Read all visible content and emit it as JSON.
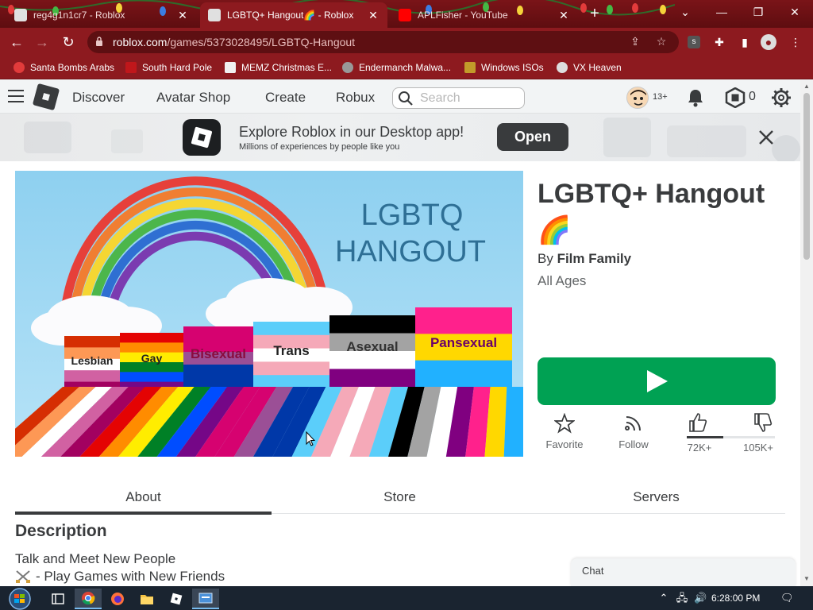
{
  "browser": {
    "tabs": [
      {
        "title": "reg4g1n1cr7 - Roblox",
        "active": false
      },
      {
        "title": "LGBTQ+ Hangout🌈 - Roblox",
        "active": true
      },
      {
        "title": "APLFisher - YouTube",
        "active": false
      }
    ],
    "url_host": "roblox.com",
    "url_path": "/games/5373028495/LGBTQ-Hangout",
    "bookmarks": [
      "Santa Bombs Arabs",
      "South Hard Pole",
      "MEMZ Christmas E...",
      "Endermanch Malwa...",
      "Windows ISOs",
      "VX Heaven"
    ],
    "theme_color": "#8d1a1f"
  },
  "header": {
    "nav": [
      "Discover",
      "Avatar Shop",
      "Create",
      "Robux"
    ],
    "search_placeholder": "Search",
    "age_badge": "13+",
    "robux_count": "0"
  },
  "banner": {
    "title": "Explore Roblox in our Desktop app!",
    "subtitle": "Millions of experiences by people like you",
    "open_label": "Open"
  },
  "game": {
    "title": "LGBTQ+ Hangout🌈",
    "by_prefix": "By",
    "creator": "Film Family",
    "age_rating": "All Ages",
    "thumbnail": {
      "sign_line1": "LGBTQ",
      "sign_line2": "HANGOUT",
      "flags": [
        {
          "label": "Lesbian",
          "colors": [
            "#d62e02",
            "#fd9855",
            "#ffffff",
            "#d161a2",
            "#a20160"
          ]
        },
        {
          "label": "Gay",
          "colors": [
            "#e40303",
            "#ff8c00",
            "#ffed00",
            "#008026",
            "#004dff",
            "#750787"
          ]
        },
        {
          "label": "Bisexual",
          "colors": [
            "#d60270",
            "#d60270",
            "#9b4f96",
            "#0038a8",
            "#0038a8"
          ]
        },
        {
          "label": "Trans",
          "colors": [
            "#5bcefa",
            "#f5a9b8",
            "#ffffff",
            "#f5a9b8",
            "#5bcefa"
          ]
        },
        {
          "label": "Asexual",
          "colors": [
            "#000000",
            "#a3a3a3",
            "#ffffff",
            "#800080"
          ]
        },
        {
          "label": "Pansexual",
          "colors": [
            "#ff218c",
            "#ffd800",
            "#21b1ff"
          ]
        }
      ]
    },
    "actions": {
      "favorite": "Favorite",
      "follow": "Follow",
      "upvotes": "72K+",
      "downvotes": "105K+",
      "upvote_fraction": 0.41
    },
    "play_color": "#00a153"
  },
  "tabs": [
    "About",
    "Store",
    "Servers"
  ],
  "description": {
    "heading": "Description",
    "lines": [
      "Talk and Meet New People",
      "- Play Games with New Friends"
    ]
  },
  "chat_label": "Chat",
  "taskbar": {
    "time": "6:28:00 PM"
  }
}
